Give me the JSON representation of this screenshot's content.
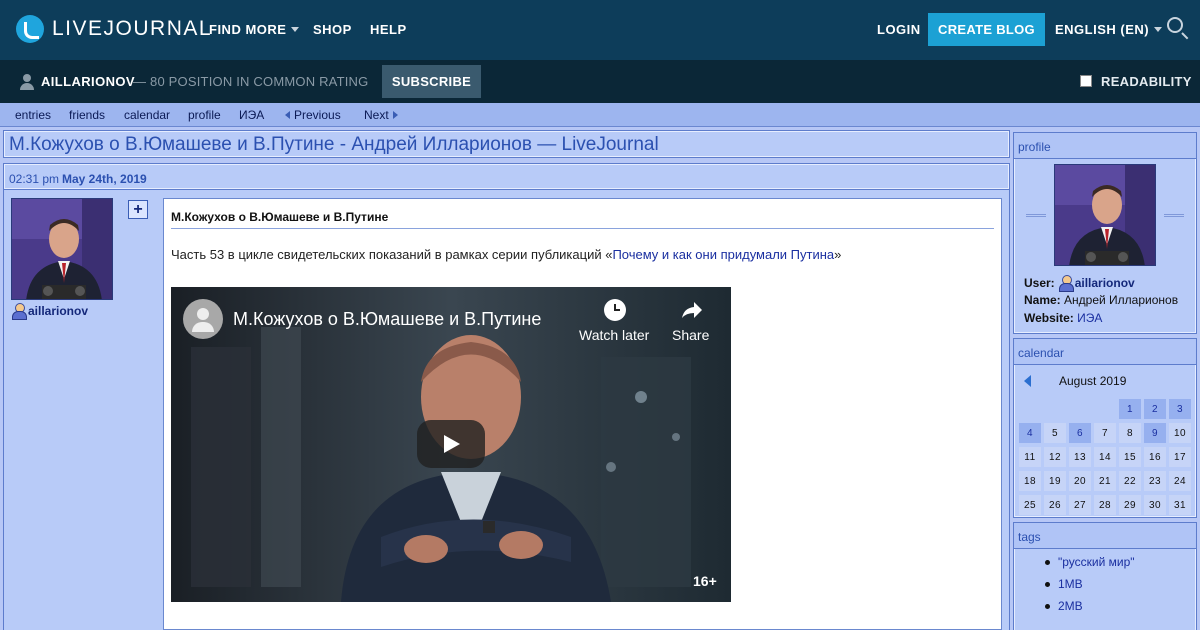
{
  "topbar": {
    "logo_text": "LIVEJOURNAL",
    "nav": [
      "FIND MORE",
      "SHOP",
      "HELP"
    ],
    "login": "LOGIN",
    "create_blog": "CREATE BLOG",
    "language": "ENGLISH (EN)"
  },
  "subbar": {
    "username": "AILLARIONOV",
    "rating": "— 80 POSITION IN COMMON RATING",
    "subscribe": "SUBSCRIBE",
    "readability": "READABILITY"
  },
  "journal_nav": {
    "entries": "entries",
    "friends": "friends",
    "calendar": "calendar",
    "profile": "profile",
    "iea": "ИЭА",
    "previous": "Previous",
    "next": "Next"
  },
  "entry": {
    "page_title": "М.Кожухов о В.Юмашеве и В.Путине - Андрей Илларионов — LiveJournal",
    "time": "02:31 pm",
    "date": "May 24th, 2019",
    "author": "aillarionov",
    "post_title": "М.Кожухов о В.Юмашеве и В.Путине",
    "body_prefix": "Часть 53 в цикле свидетельских показаний в рамках серии публикаций «",
    "body_link": "Почему и как они придумали Путина",
    "body_suffix": "»",
    "video": {
      "title": "М.Кожухов о В.Юмашеве и В.Путине",
      "watch_later": "Watch later",
      "share": "Share",
      "age_rating": "16+"
    }
  },
  "sidebar": {
    "profile": {
      "header": "profile",
      "user_label": "User:",
      "user_value": "aillarionov",
      "name_label": "Name:",
      "name_value": "Андрей Илларионов",
      "website_label": "Website:",
      "website_value": "ИЭА"
    },
    "calendar": {
      "header": "calendar",
      "month": "August 2019",
      "days": [
        "",
        "",
        "",
        "",
        "1",
        "2",
        "3",
        "4",
        "5",
        "6",
        "7",
        "8",
        "9",
        "10",
        "11",
        "12",
        "13",
        "14",
        "15",
        "16",
        "17",
        "18",
        "19",
        "20",
        "21",
        "22",
        "23",
        "24",
        "25",
        "26",
        "27",
        "28",
        "29",
        "30",
        "31"
      ],
      "posted_days": [
        "1",
        "2",
        "3",
        "4",
        "6",
        "9"
      ]
    },
    "tags": {
      "header": "tags",
      "items": [
        "\"русский мир\"",
        "1MB",
        "2MB"
      ]
    }
  },
  "colors": {
    "topbar": "#0d3d5a",
    "subbar": "#0b2737",
    "accent": "#1ca1d4",
    "page_bg": "#b7c7f6",
    "link": "#1a2fa0"
  }
}
